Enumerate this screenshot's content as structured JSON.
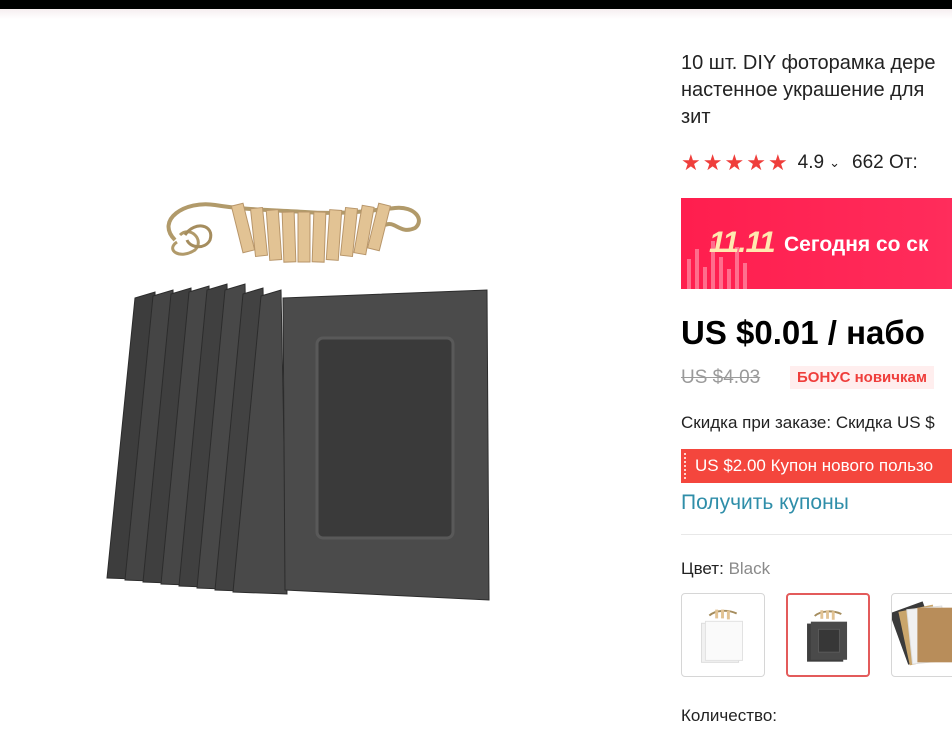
{
  "product": {
    "title": "10 шт. DIY фоторамка дере\nнастенное украшение для\nзит",
    "rating_value": "4.9",
    "reviews_text": "662 От:",
    "promo_badge": "11.11",
    "promo_text": "Сегодня со ск",
    "price": "US $0.01 / набо",
    "old_price": "US $4.03",
    "bonus_badge": "БОНУС новичкам",
    "discount_text": "Скидка при заказе: Скидка US $",
    "coupon_text": "US $2.00 Купон нового пользо",
    "get_coupons_link": "Получить купоны",
    "color_label": "Цвет:",
    "color_value": "Black",
    "quantity_label": "Количество:"
  },
  "colors": {
    "star": "#ef3e3b",
    "promo_bg": "#ff1e4e",
    "coupon_bg": "#f4463d",
    "link": "#2f8ea9",
    "selected_border": "#e35b5b"
  },
  "icons": {
    "star": "★",
    "chevron": "⌄"
  },
  "swatches": [
    "white-frames",
    "black-frames",
    "assorted-frames"
  ]
}
